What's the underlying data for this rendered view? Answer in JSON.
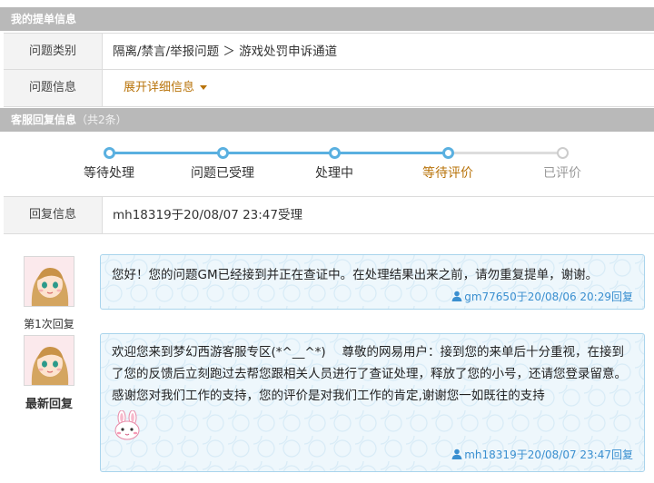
{
  "section_ticket": {
    "title": "我的提单信息"
  },
  "ticket": {
    "category_label": "问题类别",
    "category_value": "隔离/禁言/举报问题 ＞ 游戏处罚申诉通道",
    "info_label": "问题信息",
    "expand_label": "展开详细信息"
  },
  "section_replies": {
    "title": "客服回复信息",
    "count": "（共2条）"
  },
  "progress": {
    "steps": [
      {
        "label": "等待处理",
        "state": "done"
      },
      {
        "label": "问题已受理",
        "state": "done"
      },
      {
        "label": "处理中",
        "state": "done"
      },
      {
        "label": "等待评价",
        "state": "current"
      },
      {
        "label": "已评价",
        "state": "todo"
      }
    ],
    "colors": {
      "done": "#5ab0e0",
      "todo": "#cccccc",
      "current_text": "#b8730a",
      "todo_text": "#999999"
    }
  },
  "reply_info": {
    "label": "回复信息",
    "value": "mh18319于20/08/07 23:47受理"
  },
  "replies": [
    {
      "tag": "第1次回复",
      "text": "您好！您的问题GM已经接到并正在查证中。在处理结果出来之前，请勿重复提单，谢谢。",
      "meta": "gm77650于20/08/06 20:29回复"
    },
    {
      "tag": "最新回复",
      "text": "欢迎您来到梦幻西游客服专区(*^__^*)　 尊敬的网易用户：接到您的来单后十分重视，在接到了您的反馈后立刻跑过去帮您跟相关人员进行了查证处理，释放了您的小号，还请您登录留意。　 感谢您对我们工作的支持，您的评价是对我们工作的肯定,谢谢您一如既往的支持",
      "meta": "mh18319于20/08/07 23:47回复",
      "sticker": "bunny-sticker"
    }
  ]
}
